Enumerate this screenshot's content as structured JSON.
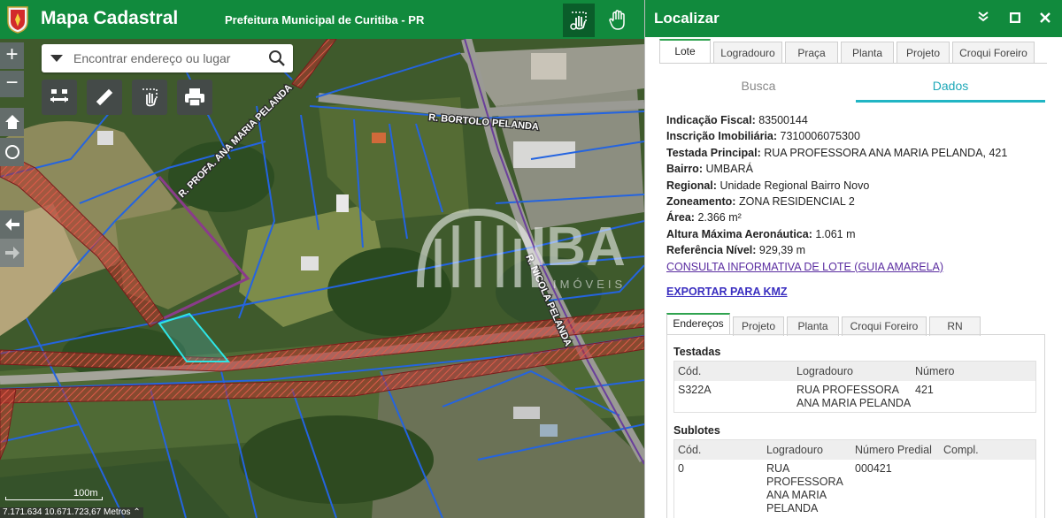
{
  "header": {
    "app_title": "Mapa Cadastral",
    "subtitle": "Prefeitura Municipal de Curitiba - PR",
    "colors": {
      "brand_green": "#118a3d"
    }
  },
  "map": {
    "search_placeholder": "Encontrar endereço ou lugar",
    "scale_label": "100m",
    "coordinates": "7.171.634 10.671.723,67 Metros",
    "street_labels": [
      "R. BORTOLO PELANDA",
      "R. PROFA. ANA MARIA PELANDA",
      "R. NICOLA PELANDA"
    ],
    "watermark_letters": "IBA",
    "watermark_small": "IMÓVEIS",
    "tools": [
      "zoom-in",
      "zoom-out",
      "home",
      "locate",
      "back",
      "forward"
    ]
  },
  "panel": {
    "title": "Localizar",
    "tabs": [
      "Lote",
      "Logradouro",
      "Praça",
      "Planta",
      "Projeto",
      "Croqui Foreiro"
    ],
    "active_tab": "Lote",
    "subtabs": {
      "busca": "Busca",
      "dados": "Dados"
    },
    "fields": [
      {
        "label": "Indicação Fiscal:",
        "value": "83500144"
      },
      {
        "label": "Inscrição Imobiliária:",
        "value": "7310006075300"
      },
      {
        "label": "Testada Principal:",
        "value": "RUA PROFESSORA ANA MARIA PELANDA, 421"
      },
      {
        "label": "Bairro:",
        "value": "UMBARÁ"
      },
      {
        "label": "Regional:",
        "value": "Unidade Regional Bairro Novo"
      },
      {
        "label": "Zoneamento:",
        "value": "ZONA RESIDENCIAL 2"
      },
      {
        "label": "Área:",
        "value": "2.366 m²"
      },
      {
        "label": "Altura Máxima Aeronáutica:",
        "value": "1.061 m"
      },
      {
        "label": "Referência Nível:",
        "value": "929,39 m"
      }
    ],
    "consulta_link": "CONSULTA INFORMATIVA DE LOTE (GUIA AMARELA)",
    "export_link": "EXPORTAR PARA KMZ",
    "tabs2": [
      "Endereços",
      "Projeto",
      "Planta",
      "Croqui Foreiro",
      "RN"
    ],
    "testadas": {
      "title": "Testadas",
      "headers": [
        "Cód.",
        "Logradouro",
        "Número"
      ],
      "rows": [
        {
          "cod": "S322A",
          "logradouro": "RUA PROFESSORA ANA MARIA PELANDA",
          "numero": "421"
        }
      ]
    },
    "sublotes": {
      "title": "Sublotes",
      "headers": [
        "Cód.",
        "Logradouro",
        "Número Predial",
        "Compl."
      ],
      "rows": [
        {
          "cod": "0",
          "logradouro": "RUA PROFESSORA ANA MARIA PELANDA",
          "numero": "000421",
          "compl": ""
        }
      ]
    }
  }
}
